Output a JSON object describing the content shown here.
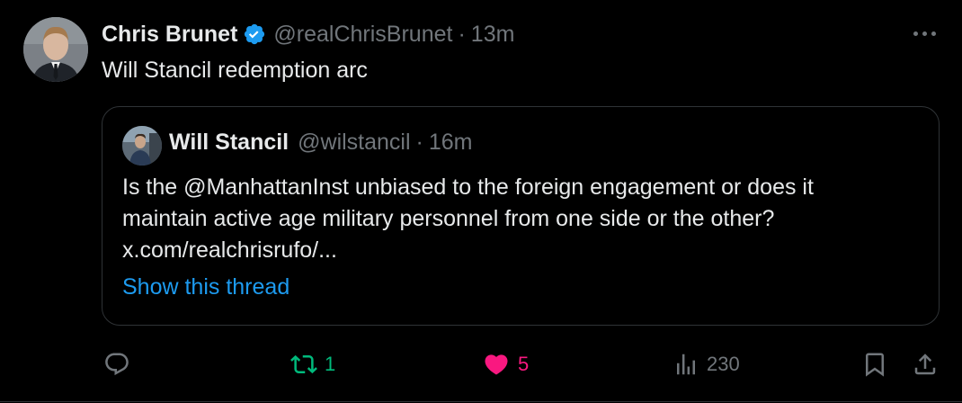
{
  "tweet": {
    "author_name": "Chris Brunet",
    "author_handle": "@realChrisBrunet",
    "separator": "·",
    "time": "13m",
    "text": "Will Stancil redemption arc"
  },
  "quote": {
    "author_name": "Will Stancil",
    "author_handle": "@wilstancil",
    "separator": "·",
    "time": "16m",
    "lines": [
      "Is the @ManhattanInst unbiased to the foreign engagement or does it",
      "maintain active age military personnel from one side or the other?",
      "x.com/realchrisrufo/..."
    ],
    "show_thread": "Show this thread"
  },
  "actions": {
    "reply_count": "",
    "retweet_count": "1",
    "like_count": "5",
    "views_count": "230"
  },
  "colors": {
    "background": "#000000",
    "text": "#e7e9ea",
    "muted": "#71767b",
    "link": "#1d9bf0",
    "retweet": "#00ba7c",
    "like": "#f91880",
    "verified": "#1d9bf0",
    "border": "#2f3336"
  },
  "icons": [
    "verified-badge-icon",
    "more-icon",
    "reply-icon",
    "retweet-icon",
    "heart-icon",
    "views-icon",
    "bookmark-icon",
    "share-icon"
  ]
}
